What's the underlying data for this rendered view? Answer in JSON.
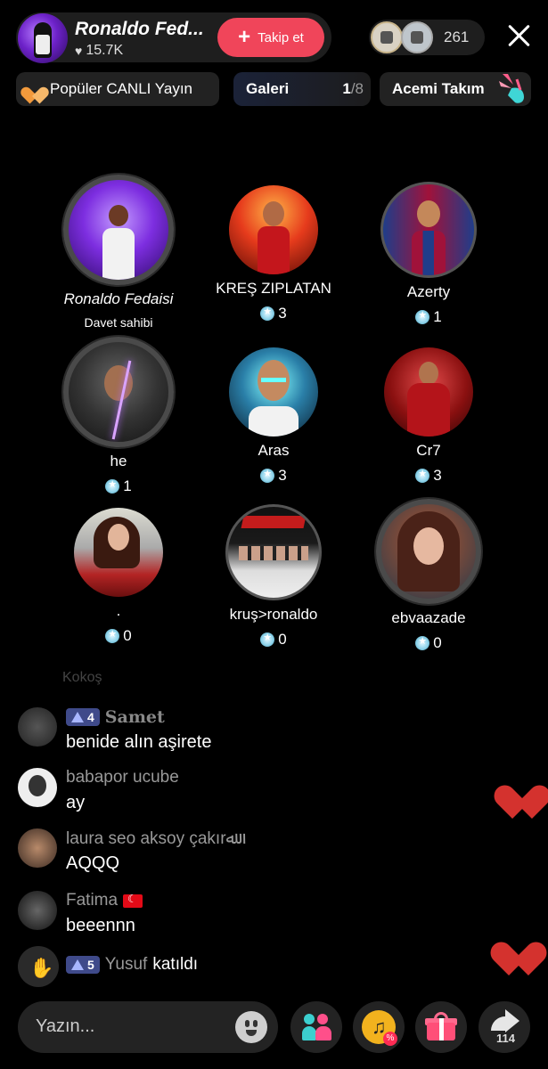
{
  "header": {
    "host_name": "Ronaldo Fed...",
    "likes": "15.7K",
    "follow_label": "Takip et",
    "viewer_count": "261"
  },
  "pills": {
    "popular": "Popüler CANLI Yayın",
    "gallery_label": "Galeri",
    "gallery_current": "1",
    "gallery_total": "/8",
    "team": "Acemi Takım"
  },
  "seats": [
    {
      "name": "Ronaldo Fedaisi",
      "sub": "Davet sahibi"
    },
    {
      "name": "KREŞ ZIPLATAN",
      "count": "3"
    },
    {
      "name": "Azerty",
      "count": "1"
    },
    {
      "name": "he",
      "count": "1"
    },
    {
      "name": "Aras",
      "count": "3"
    },
    {
      "name": "Cr7",
      "count": "3"
    },
    {
      "name": ".",
      "count": "0"
    },
    {
      "name": "kruş>ronaldo",
      "count": "0"
    },
    {
      "name": "ebvaazade",
      "count": "0"
    }
  ],
  "chat": {
    "faded": "Kokoş",
    "messages": [
      {
        "level": "4",
        "user": "Samet",
        "text": "benide alın aşirete"
      },
      {
        "user": "babapor ucube",
        "text": "ay"
      },
      {
        "user": "laura seo aksoy çakırﷲ",
        "text": "AQQQ"
      },
      {
        "user": "Fatima",
        "text": "beeennn"
      }
    ],
    "join": {
      "level": "5",
      "user": "Yusuf",
      "action": "katıldı"
    }
  },
  "bottom": {
    "input_placeholder": "Yazın...",
    "share_count": "114"
  }
}
